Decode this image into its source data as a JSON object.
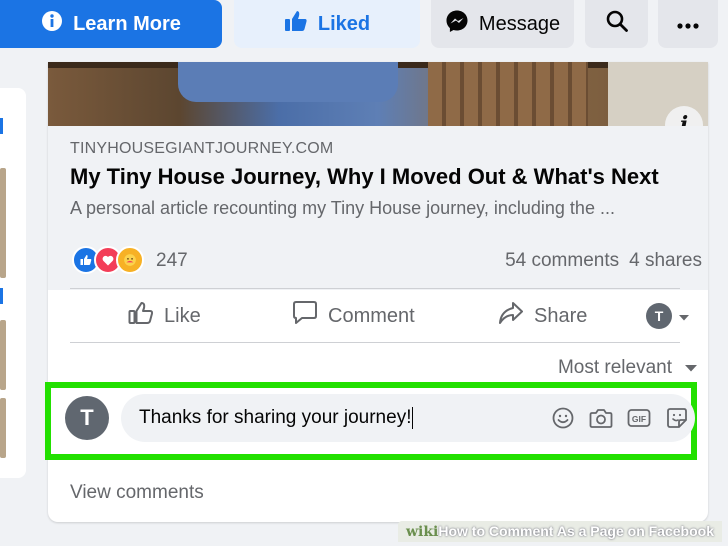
{
  "topbar": {
    "learn_more": "Learn More",
    "liked": "Liked",
    "message": "Message"
  },
  "post": {
    "link": {
      "domain": "TINYHOUSEGIANTJOURNEY.COM",
      "title": "My Tiny House Journey, Why I Moved Out & What's Next",
      "description": "A personal article recounting my Tiny House journey, including the ..."
    },
    "reactions": {
      "count": "247",
      "comments": "54 comments",
      "shares": "4 shares"
    },
    "actions": {
      "like": "Like",
      "comment": "Comment",
      "share": "Share"
    },
    "sort_label": "Most relevant",
    "composer": {
      "avatar_initial": "T",
      "value": "Thanks for sharing your journey!"
    },
    "view_comments": "View comments"
  },
  "watermark": {
    "wiki": "wiki",
    "how": "How",
    "rest": " to Comment As a Page on Facebook"
  },
  "colors": {
    "brand_blue": "#1b74e4",
    "highlight_green": "#22e000"
  }
}
